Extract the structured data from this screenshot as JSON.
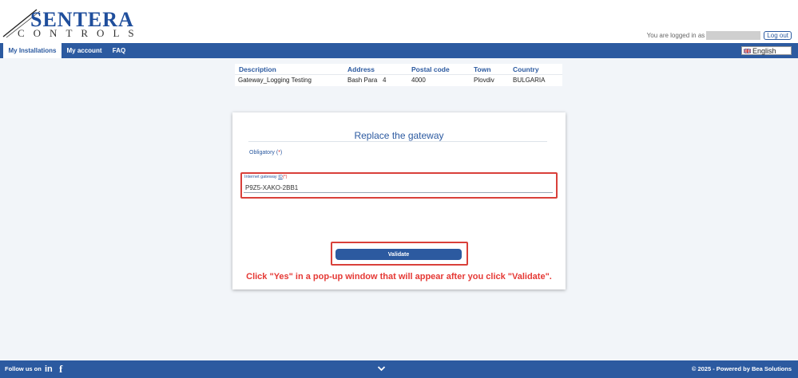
{
  "header": {
    "logo_main": "SENTERA",
    "logo_sub": "CONTROLS",
    "login_text": "You are logged in as",
    "logout_label": "Log out"
  },
  "nav": {
    "tabs": [
      {
        "label": "My Installations",
        "active": true
      },
      {
        "label": "My account",
        "active": false
      },
      {
        "label": "FAQ",
        "active": false
      }
    ],
    "language": "English"
  },
  "installations": {
    "columns": [
      "Description",
      "Address",
      "Postal code",
      "Town",
      "Country"
    ],
    "rows": [
      [
        "Gateway_Logging Testing",
        "Bash Para   4",
        "4000",
        "Plovdiv",
        "BULGARIA"
      ]
    ]
  },
  "form": {
    "title": "Replace the gateway",
    "obligatory_label": "Obligatory (",
    "obligatory_star": "*",
    "obligatory_close": ")",
    "gateway_label": "Internet gateway ",
    "gateway_label_id": "ID",
    "gateway_label_req": "(*)",
    "gateway_value": "P9Z5-XAKO-2BB1",
    "validate_label": "Validate",
    "instruction": "Click \"Yes\" in a pop-up window that will appear after you click \"Validate\"."
  },
  "footer": {
    "follow_label": "Follow us on",
    "linkedin": "in",
    "facebook": "f",
    "copyright": "© 2025 - Powered by Bea Solutions"
  },
  "colors": {
    "brand_blue": "#2c5aa0",
    "highlight_red": "#d9403a",
    "background": "#f2f5f9"
  }
}
